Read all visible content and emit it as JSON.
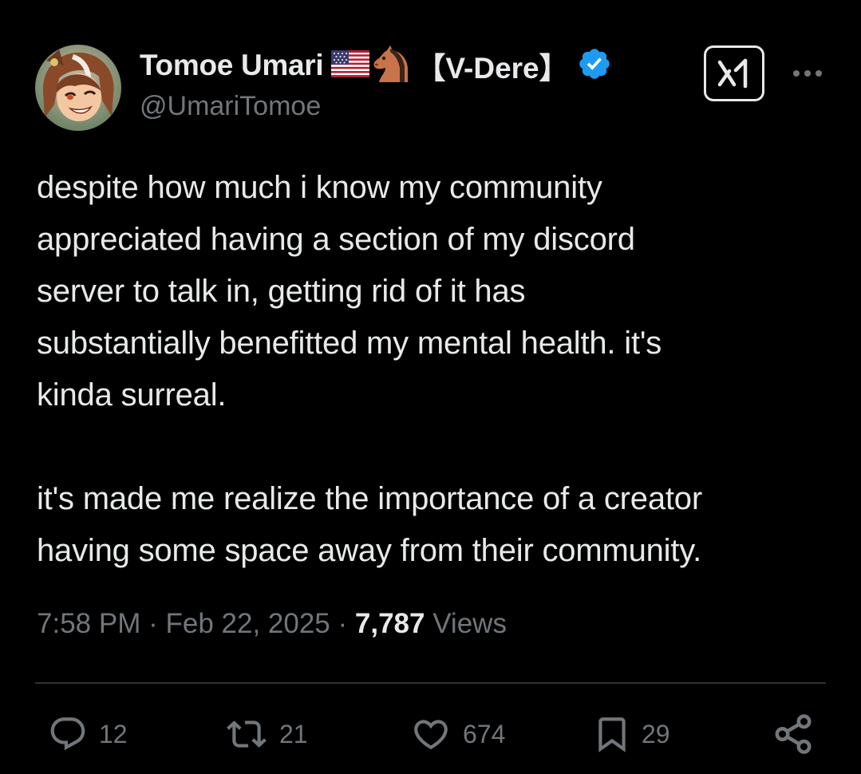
{
  "user": {
    "display_name": "Tomoe Umari",
    "name_tag": "【V-Dere】",
    "handle": "@UmariTomoe",
    "name_icons": [
      "us-flag-icon",
      "horse-icon"
    ],
    "verified_icon": "verified-badge-icon"
  },
  "header_actions": {
    "grok_icon": "grok-icon",
    "more_icon": "more-dots-icon"
  },
  "tweet": {
    "paragraphs": [
      [
        "despite how much i know my community",
        "appreciated having a section of my discord",
        "server to talk in, getting rid of it has",
        "substantially benefitted my mental health. it's",
        "kinda surreal."
      ],
      [
        "it's made me realize the importance of a creator",
        "having some space away from their community."
      ]
    ]
  },
  "meta": {
    "time": "7:58 PM",
    "date": "Feb 22, 2025",
    "separator": "·",
    "views_count": "7,787",
    "views_label": "Views"
  },
  "actions": {
    "reply": {
      "icon": "reply-icon",
      "count": "12"
    },
    "repost": {
      "icon": "repost-icon",
      "count": "21"
    },
    "like": {
      "icon": "like-icon",
      "count": "674"
    },
    "bookmark": {
      "icon": "bookmark-icon",
      "count": "29"
    },
    "share": {
      "icon": "share-icon"
    }
  },
  "colors": {
    "background": "#000000",
    "text_primary": "#e7e9ea",
    "text_secondary": "#71767b",
    "verified_blue": "#1d9bf0",
    "divider": "#2f3336"
  }
}
